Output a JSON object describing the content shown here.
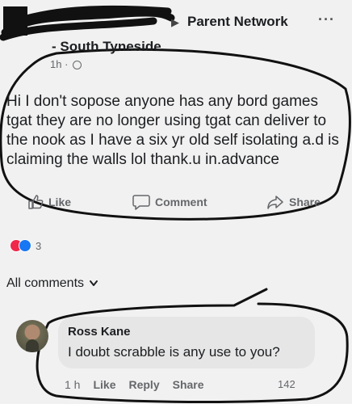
{
  "header": {
    "group_name": "Parent Network",
    "group_sub": "- South Tyneside",
    "timestamp": "1h ·",
    "more_label": "···"
  },
  "post": {
    "text": "Hi I don't sopose anyone has any bord games tgat they are no longer using tgat can deliver to the nook as I have a six yr old self isolating a.d is claiming the walls lol  thank.u in.advance"
  },
  "actions": {
    "like": "Like",
    "comment": "Comment",
    "share": "Share"
  },
  "reactions": {
    "count": "3",
    "colors": {
      "love": "#f0284a",
      "like": "#1877f2"
    }
  },
  "comments_filter": "All comments",
  "comment": {
    "author": "Ross Kane",
    "text": "I doubt scrabble is any use to you?",
    "time": "1 h",
    "like": "Like",
    "reply": "Reply",
    "share": "Share",
    "extra": "142"
  }
}
